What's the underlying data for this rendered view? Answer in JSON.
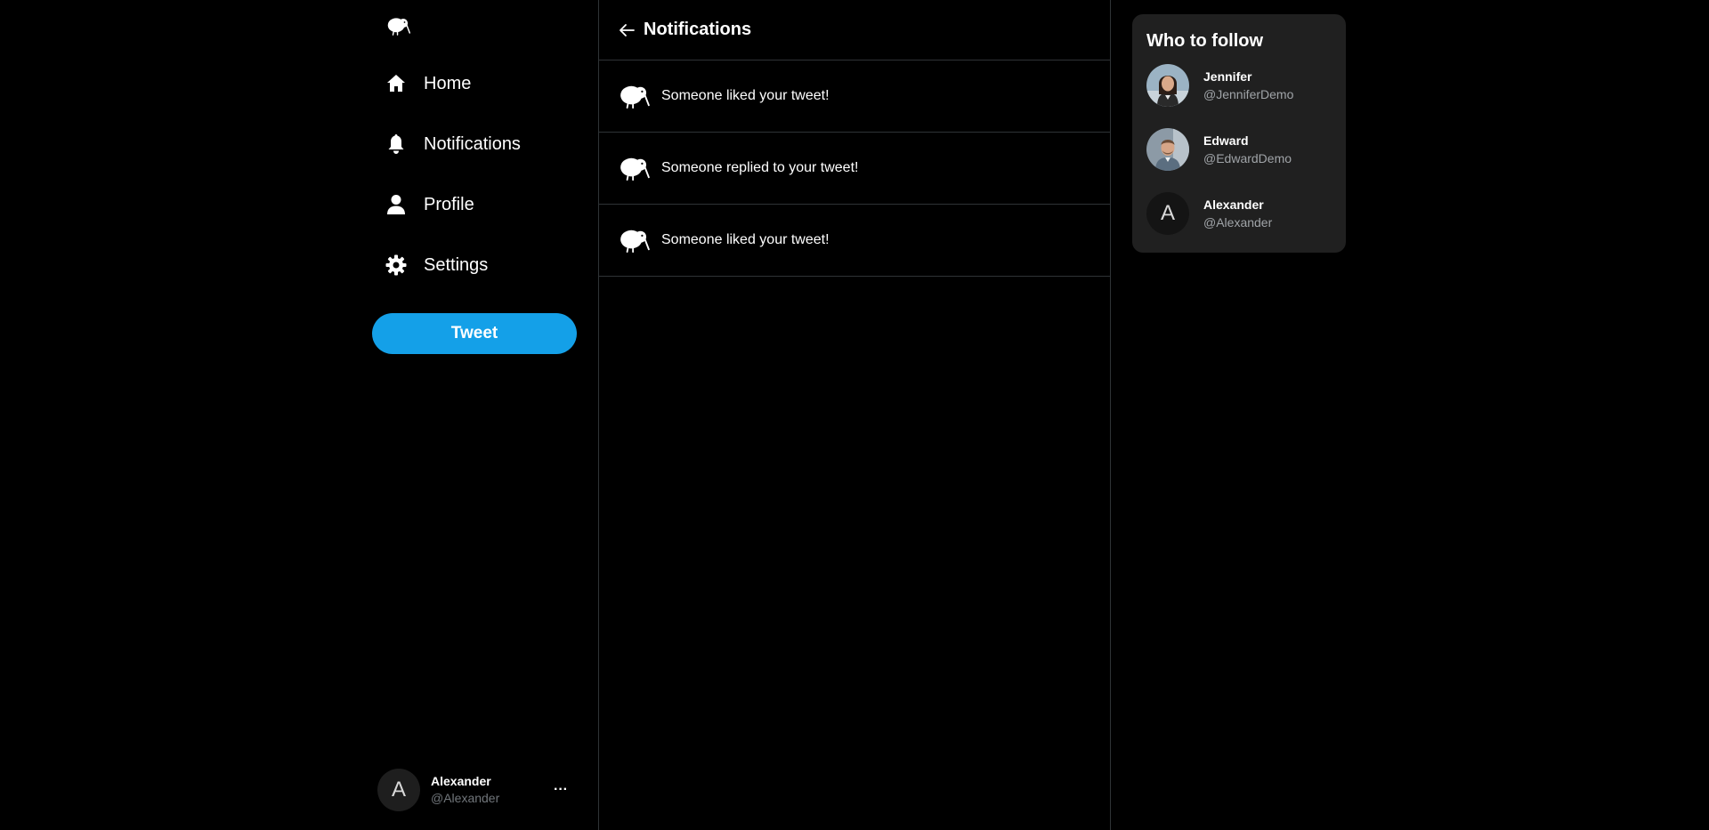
{
  "colors": {
    "background": "#000000",
    "accent": "#14a0e8",
    "card": "#202020",
    "divider": "#2f3336",
    "muted_text": "#71767b"
  },
  "sidebar": {
    "logo_icon": "kiwi-bird-icon",
    "items": [
      {
        "label": "Home",
        "icon": "home-icon"
      },
      {
        "label": "Notifications",
        "icon": "bell-icon"
      },
      {
        "label": "Profile",
        "icon": "user-icon"
      },
      {
        "label": "Settings",
        "icon": "gear-icon"
      }
    ],
    "tweet_label": "Tweet",
    "account": {
      "avatar_letter": "A",
      "name": "Alexander",
      "handle": "@Alexander",
      "more_label": "···"
    }
  },
  "main": {
    "back_icon": "arrow-left-icon",
    "title": "Notifications",
    "notifications": [
      {
        "text": "Someone liked your tweet!",
        "icon": "kiwi-bird-icon"
      },
      {
        "text": "Someone replied to your tweet!",
        "icon": "kiwi-bird-icon"
      },
      {
        "text": "Someone liked your tweet!",
        "icon": "kiwi-bird-icon"
      }
    ]
  },
  "who_to_follow": {
    "title": "Who to follow",
    "users": [
      {
        "name": "Jennifer",
        "handle": "@JenniferDemo",
        "avatar": "photo"
      },
      {
        "name": "Edward",
        "handle": "@EdwardDemo",
        "avatar": "photo"
      },
      {
        "name": "Alexander",
        "handle": "@Alexander",
        "avatar_letter": "A"
      }
    ]
  }
}
